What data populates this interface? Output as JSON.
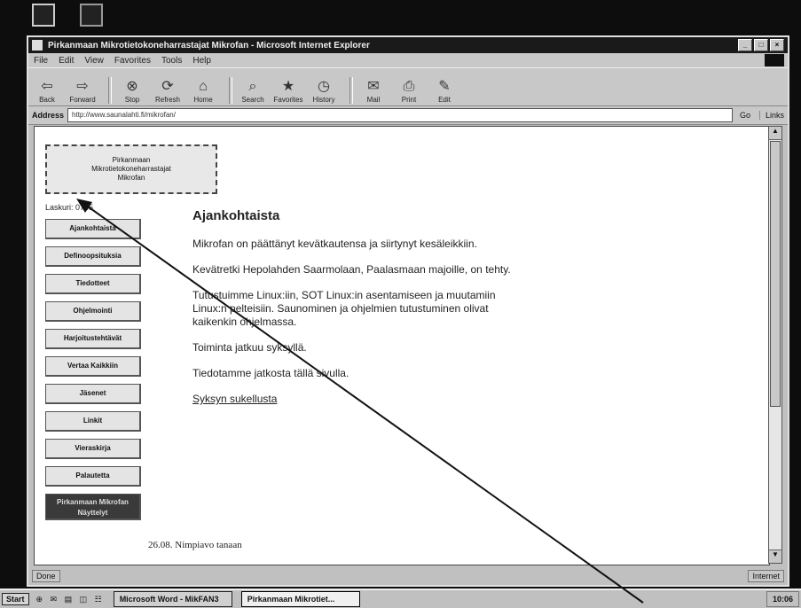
{
  "window": {
    "title": "Pirkanmaan Mikrotietokoneharrastajat Mikrofan - Microsoft Internet Explorer",
    "controls": [
      "_",
      "□",
      "×"
    ]
  },
  "menu": [
    "File",
    "Edit",
    "View",
    "Favorites",
    "Tools",
    "Help"
  ],
  "toolbar": [
    {
      "label": "Back",
      "icon": "back-arrow-icon"
    },
    {
      "label": "Forward",
      "icon": "forward-arrow-icon"
    },
    {
      "label": "Stop",
      "icon": "stop-icon"
    },
    {
      "label": "Refresh",
      "icon": "refresh-icon"
    },
    {
      "label": "Home",
      "icon": "home-icon"
    },
    {
      "label": "Search",
      "icon": "search-icon"
    },
    {
      "label": "Favorites",
      "icon": "favorites-icon"
    },
    {
      "label": "History",
      "icon": "history-icon"
    },
    {
      "label": "Mail",
      "icon": "mail-icon"
    },
    {
      "label": "Print",
      "icon": "print-icon"
    },
    {
      "label": "Edit",
      "icon": "edit-icon"
    }
  ],
  "address": {
    "label": "Address",
    "value": "http://www.saunalahti.fi/mikrofan/",
    "go": "Go",
    "links": "Links"
  },
  "page": {
    "logo_lines": [
      "Pirkanmaan",
      "Mikrotietokoneharrastajat",
      "Mikrofan"
    ],
    "counter": "Laskuri: 0765",
    "nav": [
      "Ajankohtaista",
      "Definoopsituksia",
      "Tiedotteet",
      "Ohjelmointi",
      "Harjoitustehtävät",
      "Vertaa Kaikkiin",
      "Jäsenet",
      "Linkit",
      "Vieraskirja",
      "Palautetta",
      "Pirkanmaan Mikrofan Näyttelyt"
    ],
    "heading": "Ajankohtaista",
    "paragraphs": [
      "Mikrofan on päättänyt kevätkautensa ja siirtynyt kesäleikkiin.",
      "Kevätretki Hepolahden Saarmolaan, Paalasmaan majoille, on tehty.",
      "Tutustuimme Linux:iin, SOT Linux:in asentamiseen ja muutamiin Linux:n pelteisiin. Saunominen ja ohjelmien tutustuminen olivat kaikenkin ohjelmassa.",
      "Toiminta jatkuu syksyllä.",
      "Tiedotamme jatkosta tällä sivulla."
    ],
    "link": "Syksyn sukellusta",
    "footer": "26.08. Nimpiavo tanaan"
  },
  "status": {
    "left": "Done",
    "zone": "Internet"
  },
  "taskbar": {
    "start": "Start",
    "quicklaunch": "⊕ ✉ ▤ ◫ ☷",
    "tasks": [
      "Microsoft Word - MikFAN3",
      "Pirkanmaan Mikrotiet..."
    ],
    "clock": "10:06"
  },
  "colors": {
    "desktop": "#0d0d0d",
    "window": "#c0c0c0",
    "content": "#ffffff"
  }
}
